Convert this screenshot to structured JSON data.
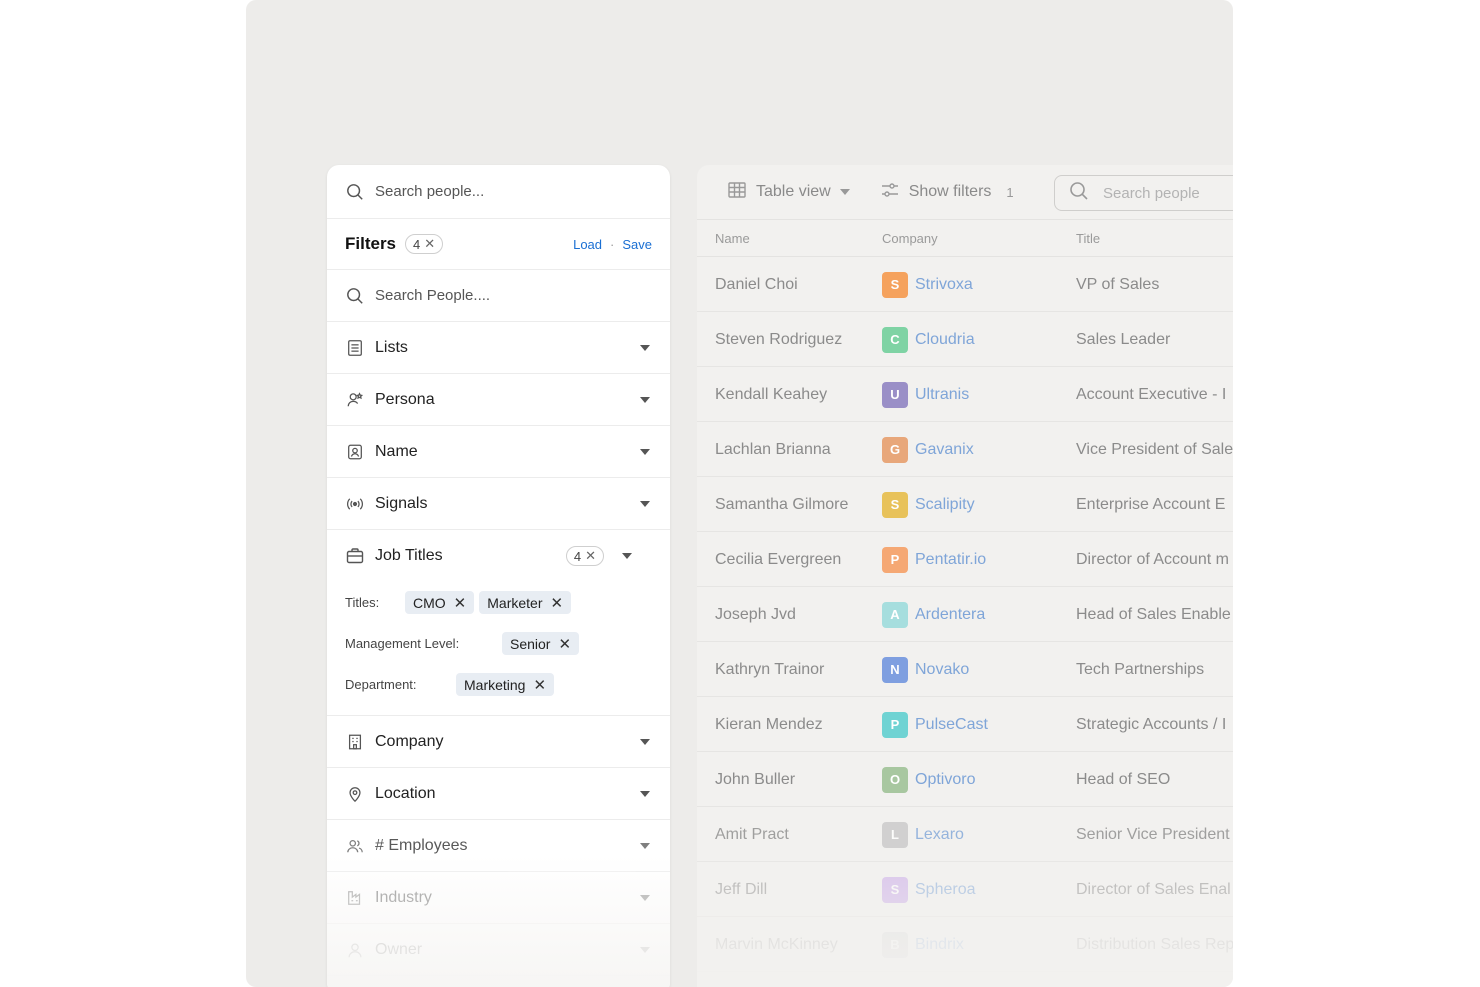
{
  "filter_panel": {
    "top_search_placeholder": "Search people...",
    "header": {
      "title": "Filters",
      "count": "4",
      "load": "Load",
      "separator": "·",
      "save": "Save"
    },
    "search_placeholder": "Search People....",
    "items": [
      {
        "label": "Lists",
        "icon": "list-icon"
      },
      {
        "label": "Persona",
        "icon": "persona-icon"
      },
      {
        "label": "Name",
        "icon": "id-badge-icon"
      },
      {
        "label": "Signals",
        "icon": "broadcast-icon"
      }
    ],
    "job_titles": {
      "label": "Job Titles",
      "count": "4",
      "icon": "briefcase-icon",
      "titles_label": "Titles:",
      "titles": [
        "CMO",
        "Marketer"
      ],
      "management_label": "Management Level:",
      "management": [
        "Senior"
      ],
      "department_label": "Department:",
      "department": [
        "Marketing"
      ]
    },
    "items_after": [
      {
        "label": "Company",
        "icon": "building-icon"
      },
      {
        "label": "Location",
        "icon": "map-pin-icon"
      },
      {
        "label": "# Employees",
        "icon": "people-icon"
      },
      {
        "label": "Industry",
        "icon": "factory-icon"
      },
      {
        "label": "Owner",
        "icon": "user-icon"
      }
    ]
  },
  "table_panel": {
    "toolbar": {
      "view_label": "Table view",
      "filters_label": "Show filters",
      "filters_count": "1",
      "search_placeholder": "Search people"
    },
    "columns": [
      "Name",
      "Company",
      "Title"
    ],
    "rows": [
      {
        "name": "Daniel Choi",
        "company": "Strivoxa",
        "title": "VP of Sales",
        "logo_color": "#f5a25d",
        "logo_char": "S"
      },
      {
        "name": "Steven Rodriguez",
        "company": "Cloudria",
        "title": "Sales Leader",
        "logo_color": "#7fd3a4",
        "logo_char": "C"
      },
      {
        "name": "Kendall Keahey",
        "company": "Ultranis",
        "title": "Account Executive - I",
        "logo_color": "#9a8fc7",
        "logo_char": "U"
      },
      {
        "name": "Lachlan Brianna",
        "company": "Gavanix",
        "title": "Vice President of Sale",
        "logo_color": "#e8a77a",
        "logo_char": "G"
      },
      {
        "name": "Samantha Gilmore",
        "company": "Scalipity",
        "title": "Enterprise Account E",
        "logo_color": "#e8c25a",
        "logo_char": "S"
      },
      {
        "name": "Cecilia Evergreen",
        "company": "Pentatir.io",
        "title": "Director of Account m",
        "logo_color": "#f5a874",
        "logo_char": "P"
      },
      {
        "name": "Joseph Jvd",
        "company": "Ardentera",
        "title": "Head of Sales Enable",
        "logo_color": "#a6dede",
        "logo_char": "A"
      },
      {
        "name": "Kathryn Trainor",
        "company": "Novako",
        "title": "Tech Partnerships",
        "logo_color": "#7f9fe0",
        "logo_char": "N"
      },
      {
        "name": "Kieran Mendez",
        "company": "PulseCast",
        "title": "Strategic Accounts / I",
        "logo_color": "#6fd3d3",
        "logo_char": "P"
      },
      {
        "name": "John Buller",
        "company": "Optivoro",
        "title": "Head of SEO",
        "logo_color": "#a8c7a0",
        "logo_char": "O"
      },
      {
        "name": "Amit Pract",
        "company": "Lexaro",
        "title": "Senior Vice President",
        "logo_color": "#c9c9c9",
        "logo_char": "L"
      },
      {
        "name": "Jeff Dill",
        "company": "Spheroa",
        "title": "Director of Sales Enal",
        "logo_color": "#c9a8e8",
        "logo_char": "S"
      },
      {
        "name": "Marvin McKinney",
        "company": "Bindrix",
        "title": "Distribution Sales Rep",
        "logo_color": "#d0d0d0",
        "logo_char": "B"
      }
    ]
  }
}
